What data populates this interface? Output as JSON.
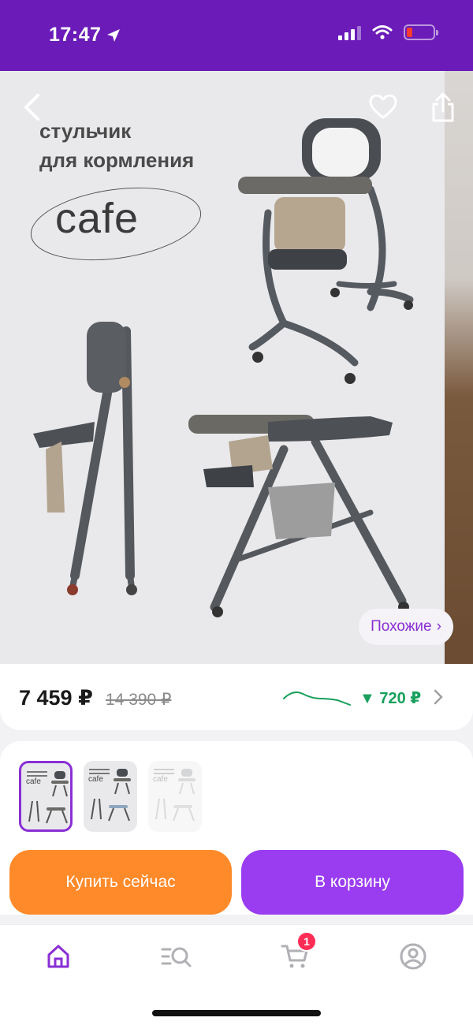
{
  "status_bar": {
    "time": "17:47",
    "icons": [
      "location-arrow-icon",
      "cellular-signal-icon",
      "wifi-icon",
      "battery-low-icon"
    ]
  },
  "hero": {
    "headline_line1": "стульчик",
    "headline_line2": "для кормления",
    "brand": "cafe",
    "similar_label": "Похожие",
    "similar_chevron": "›",
    "icons": [
      "back-chevron-icon",
      "heart-icon",
      "share-icon"
    ]
  },
  "price": {
    "current": "7 459 ₽",
    "old": "14 390 ₽",
    "drop": "▼ 720 ₽",
    "colors": {
      "trend": "#18a05c",
      "accent": "#8a2fd4"
    }
  },
  "thumbnails": [
    {
      "caption": "cafe",
      "selected": true
    },
    {
      "caption": "cafe",
      "selected": false
    },
    {
      "caption": "cafe",
      "selected": false
    }
  ],
  "actions": {
    "buy_now": "Купить сейчас",
    "add_to_cart": "В корзину",
    "colors": {
      "buy": "#ff8a2a",
      "cart": "#9a3cf0"
    }
  },
  "tabbar": {
    "items": [
      {
        "icon": "home-icon",
        "active": true
      },
      {
        "icon": "catalog-search-icon",
        "active": false
      },
      {
        "icon": "cart-icon",
        "active": false,
        "badge": "1"
      },
      {
        "icon": "profile-icon",
        "active": false
      }
    ]
  }
}
